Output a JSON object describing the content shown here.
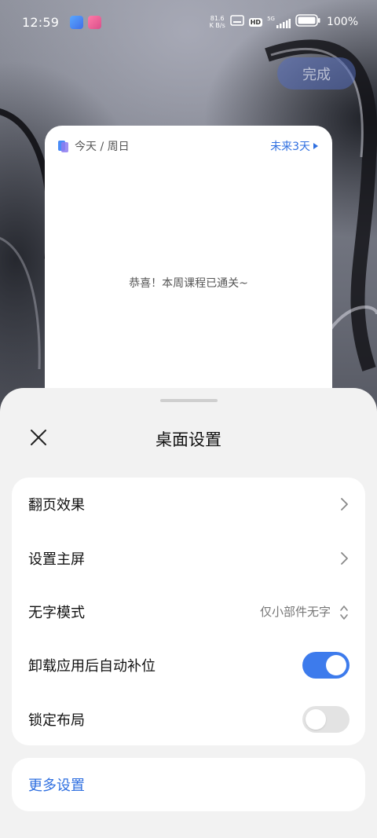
{
  "status_bar": {
    "time": "12:59",
    "net_speed_value": "81.6",
    "net_speed_unit": "K B/s",
    "hd_label": "HD",
    "network_label": "5G",
    "battery_percent": "100%"
  },
  "done_button": {
    "label": "完成"
  },
  "widget": {
    "date_label": "今天 / 周日",
    "next_label": "未来3天",
    "message": "恭喜！本周课程已通关~"
  },
  "sheet": {
    "title": "桌面设置",
    "rows": [
      {
        "label": "翻页效果",
        "control": "chevron"
      },
      {
        "label": "设置主屏",
        "control": "chevron"
      },
      {
        "label": "无字模式",
        "value": "仅小部件无字",
        "control": "updown"
      },
      {
        "label": "卸载应用后自动补位",
        "control": "toggle",
        "state": "on"
      },
      {
        "label": "锁定布局",
        "control": "toggle",
        "state": "off"
      }
    ],
    "more_label": "更多设置"
  },
  "colors": {
    "accent": "#3d7bec",
    "link": "#2f6fe0",
    "sheet_bg": "#f2f2f2",
    "card_bg": "#ffffff"
  }
}
